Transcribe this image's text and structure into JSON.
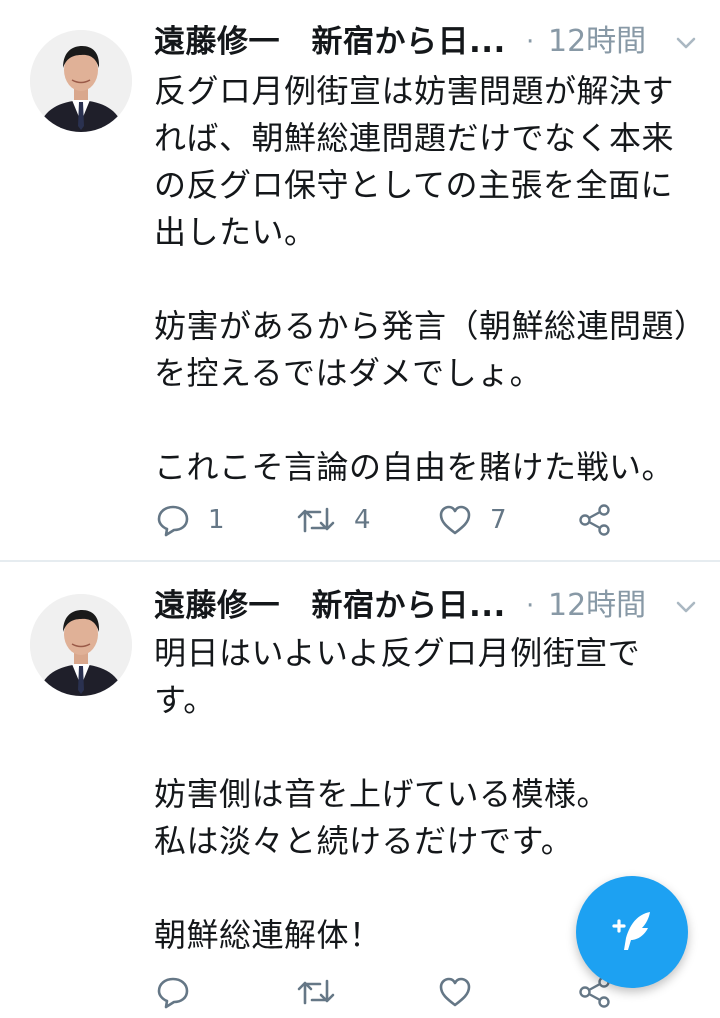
{
  "tweets": [
    {
      "author": "遠藤修一　新宿から日...",
      "separator": "·",
      "time": "12時間",
      "text": "反グロ月例街宣は妨害問題が解決すれば、朝鮮総連問題だけでなく本来の反グロ保守としての主張を全面に出したい。\n\n妨害があるから発言（朝鮮総連問題）を控えるではダメでしょ。\n\nこれこそ言論の自由を賭けた戦い。",
      "reply_count": "1",
      "retweet_count": "4",
      "like_count": "7"
    },
    {
      "author": "遠藤修一　新宿から日...",
      "separator": "·",
      "time": "12時間",
      "text": "明日はいよいよ反グロ月例街宣です。\n\n妨害側は音を上げている模様。\n私は淡々と続けるだけです。\n\n朝鮮総連解体！",
      "reply_count": "",
      "retweet_count": "",
      "like_count": ""
    }
  ],
  "icons": {
    "reply": "reply-icon",
    "retweet": "retweet-icon",
    "like": "heart-icon",
    "share": "share-icon",
    "menu": "chevron-down-icon",
    "compose": "compose-tweet-icon"
  },
  "colors": {
    "accent": "#1da1f2",
    "muted": "#8899a6",
    "text": "#14171a"
  }
}
